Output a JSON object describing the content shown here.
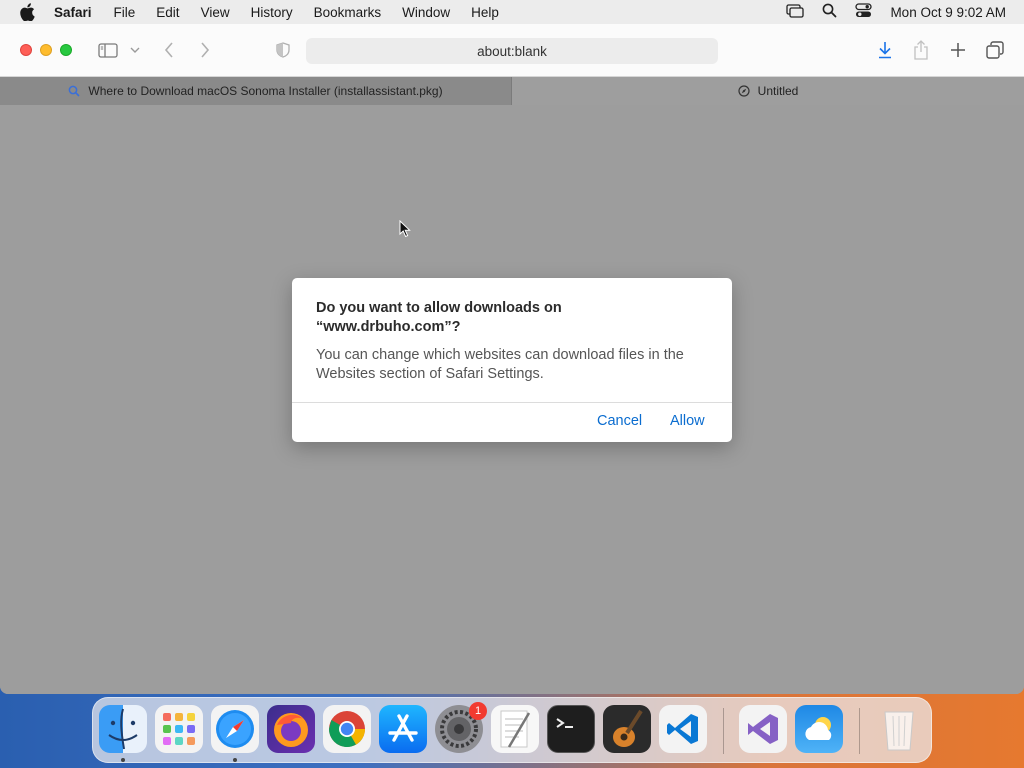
{
  "menubar": {
    "app_name": "Safari",
    "items": [
      "File",
      "Edit",
      "View",
      "History",
      "Bookmarks",
      "Window",
      "Help"
    ],
    "clock": "Mon Oct 9  9:02 AM"
  },
  "toolbar": {
    "address": "about:blank"
  },
  "tabs": [
    {
      "label": "Where to Download macOS Sonoma Installer (installassistant.pkg)"
    },
    {
      "label": "Untitled"
    }
  ],
  "dialog": {
    "title": "Do you want to allow downloads on “www.drbuho.com”?",
    "message": "You can change which websites can download files in the Websites section of Safari Settings.",
    "cancel_label": "Cancel",
    "allow_label": "Allow"
  },
  "dock": {
    "badge_count": "1",
    "apps": [
      "Finder",
      "Launchpad",
      "Safari",
      "Firefox",
      "Chrome",
      "App Store",
      "System Settings",
      "TextEdit",
      "Terminal",
      "GarageBand",
      "Visual Studio Code",
      "Visual Studio",
      "Weather",
      "Trash"
    ]
  },
  "colors": {
    "accent": "#0a6ccf",
    "close": "#fe5f57",
    "minimize": "#febc2e",
    "maximize": "#28c840"
  }
}
